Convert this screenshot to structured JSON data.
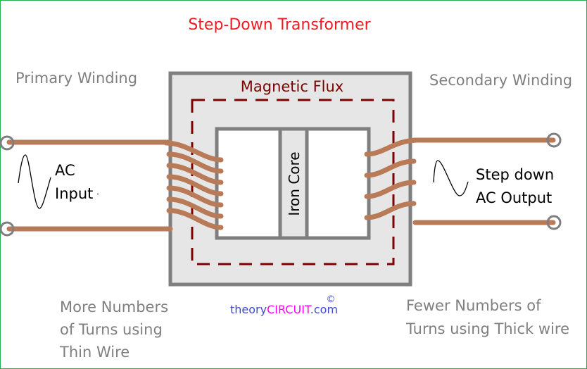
{
  "title": "Step-Down Transformer",
  "labels": {
    "primary_winding": "Primary Winding",
    "secondary_winding": "Secondary Winding",
    "magnetic_flux": "Magnetic Flux",
    "iron_core": "Iron Core",
    "ac_input_line1": "AC",
    "ac_input_line2": "Input",
    "ac_output_line1": "Step down",
    "ac_output_line2": "AC Output",
    "primary_note_line1": "More Numbers",
    "primary_note_line2": "of Turns using",
    "primary_note_line3": "Thin Wire",
    "secondary_note_line1": "Fewer Numbers of",
    "secondary_note_line2": "Turns using Thick wire"
  },
  "watermark": {
    "prefix": "theory",
    "highlight": "CIRCUIT",
    "suffix": ".com",
    "copyright": "©"
  },
  "primary_turns": 7,
  "secondary_turns": 4,
  "colors": {
    "title": "#ed1c24",
    "text_gray": "#7f7f7f",
    "flux": "#800000",
    "core_fill": "#e6e6e6",
    "core_stroke": "#7f7f7f",
    "wire": "#b97a57",
    "terminal": "#7f7f7f",
    "border": "#22b14c",
    "brand_blue": "#3f48cc",
    "brand_magenta": "#ff00ff"
  }
}
